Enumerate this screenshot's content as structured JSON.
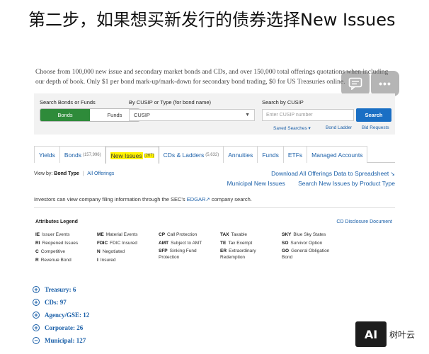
{
  "headline": "第二步，如果想买新发行的债券选择New Issues",
  "intro": "Choose from 100,000 new issue and secondary market bonds and CDs, and over 150,000 total offerings quotations when including our depth of book. Only $1 per bond mark-up/mark-down for secondary bond trading, $0 for US Treasuries online.",
  "overlay": {
    "comment_icon": "comment-icon",
    "more_icon": "more-icon",
    "more_glyph": "•••"
  },
  "search": {
    "bonds_funds_label": "Search Bonds or Funds",
    "bonds_label": "Bonds",
    "funds_label": "Funds",
    "cusip_type_label": "By CUSIP or Type (for bond name)",
    "select_value": "CUSIP",
    "search_by_cusip_label": "Search by CUSIP",
    "cusip_placeholder": "Enter CUSIP number",
    "search_button": "Search",
    "saved_searches": "Saved Searches",
    "bond_ladder": "Bond Ladder",
    "bid_requests": "Bid Requests"
  },
  "tabs": [
    {
      "label": "Yields",
      "count": ""
    },
    {
      "label": "Bonds",
      "count": "(157,996)"
    },
    {
      "label": "New Issues",
      "count": "(267)"
    },
    {
      "label": "CDs & Ladders",
      "count": "(5,632)"
    },
    {
      "label": "Annuities",
      "count": ""
    },
    {
      "label": "Funds",
      "count": ""
    },
    {
      "label": "ETFs",
      "count": ""
    },
    {
      "label": "Managed Accounts",
      "count": ""
    }
  ],
  "view": {
    "label": "View by:",
    "bond_type": "Bond Type",
    "sep": "|",
    "all_offerings": "All Offerings",
    "download": "Download All Offerings Data to Spreadsheet",
    "municipal": "Municipal New Issues",
    "search_product": "Search New Issues by Product Type"
  },
  "sec": {
    "before": "Investors can view company filing information through the SEC's",
    "edgar": "EDGAR",
    "after": "company search."
  },
  "legend": {
    "title": "Attributes Legend",
    "cd_link": "CD Disclosure Document",
    "columns": [
      [
        {
          "code": "IE",
          "text": "Issuer Events"
        },
        {
          "code": "RI",
          "text": "Reopened Issues"
        },
        {
          "code": "C",
          "text": "Competitive"
        },
        {
          "code": "R",
          "text": "Revenue Bond"
        }
      ],
      [
        {
          "code": "ME",
          "text": "Material Events"
        },
        {
          "code": "FDIC",
          "text": "FDIC Insured"
        },
        {
          "code": "N",
          "text": "Negotiated"
        },
        {
          "code": "I",
          "text": "Insured"
        }
      ],
      [
        {
          "code": "CP",
          "text": "Call Protection"
        },
        {
          "code": "AMT",
          "text": "Subject to AMT"
        },
        {
          "code": "SFP",
          "text": "Sinking Fund Protection"
        }
      ],
      [
        {
          "code": "TAX",
          "text": "Taxable"
        },
        {
          "code": "TE",
          "text": "Tax Exempt"
        },
        {
          "code": "ER",
          "text": "Extraordinary Redemption"
        }
      ],
      [
        {
          "code": "SKY",
          "text": "Blue Sky States"
        },
        {
          "code": "SO",
          "text": "Survivor Option"
        },
        {
          "code": "GO",
          "text": "General Obligation Bond"
        }
      ]
    ]
  },
  "categories": [
    {
      "label": "Treasury: 6"
    },
    {
      "label": "CDs: 97"
    },
    {
      "label": "Agency/GSE: 12"
    },
    {
      "label": "Corporate: 26"
    },
    {
      "label": "Municipal: 127"
    }
  ],
  "watermark": {
    "logo": "AI",
    "text": "树叶云"
  }
}
